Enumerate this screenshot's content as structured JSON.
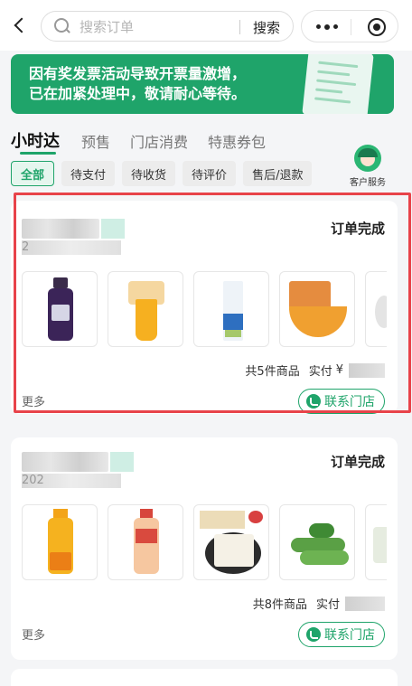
{
  "search": {
    "placeholder": "搜索订单",
    "button_label": "搜索"
  },
  "banner": {
    "line1": "因有奖发票活动导致开票量激增，",
    "line2": "已在加紧处理中，敬请耐心等待。"
  },
  "main_tabs": [
    {
      "label": "小时达",
      "active": true
    },
    {
      "label": "预售",
      "active": false
    },
    {
      "label": "门店消费",
      "active": false
    },
    {
      "label": "特惠券包",
      "active": false
    }
  ],
  "filters": [
    {
      "label": "全部",
      "active": true
    },
    {
      "label": "待支付",
      "active": false
    },
    {
      "label": "待收货",
      "active": false
    },
    {
      "label": "待评价",
      "active": false
    },
    {
      "label": "售后/退款",
      "active": false
    }
  ],
  "service": {
    "label": "客户服务"
  },
  "orders": [
    {
      "status": "订单完成",
      "date_prefix": "2",
      "count_text": "共5件商品",
      "paid_label": "实付",
      "paid_prefix": "¥",
      "more": "更多",
      "contact": "联系门店",
      "thumbs": [
        "blueberry-juice-bottle",
        "orange-juice-cup",
        "milk-carton",
        "orange-bowl",
        "partial-item"
      ]
    },
    {
      "status": "订单完成",
      "date_prefix": "202",
      "count_text": "共8件商品",
      "paid_label": "实付",
      "paid_prefix": "",
      "more": "更多",
      "contact": "联系门店",
      "thumbs": [
        "juice-bottle",
        "drink-bottle",
        "tofu",
        "green-beans",
        "partial-item"
      ]
    }
  ],
  "colors": {
    "brand_green": "#1fa46a",
    "highlight_red": "#e8434a"
  }
}
